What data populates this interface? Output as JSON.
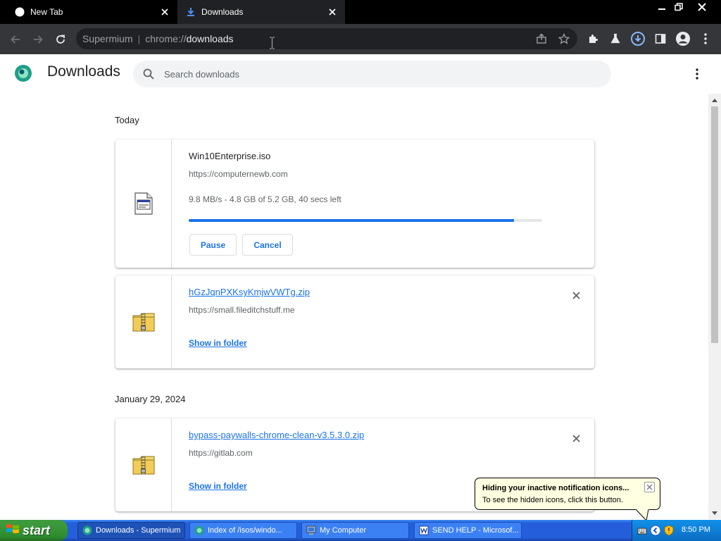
{
  "browser": {
    "tabs": [
      {
        "title": "New Tab",
        "icon": "globe-icon"
      },
      {
        "title": "Downloads",
        "icon": "download-icon"
      }
    ],
    "omnibox": {
      "brand": "Supermium",
      "separator": "|",
      "scheme": "chrome://",
      "host": "downloads"
    }
  },
  "downloads_page": {
    "title": "Downloads",
    "search_placeholder": "Search downloads",
    "sections": [
      {
        "date": "Today",
        "items": [
          {
            "filename": "Win10Enterprise.iso",
            "url": "https://computernewb.com",
            "status": "9.8 MB/s - 4.8 GB of 5.2 GB, 40 secs left",
            "progress_fraction": 0.92,
            "pause_label": "Pause",
            "cancel_label": "Cancel"
          },
          {
            "filename": "hGzJqnPXKsyKmjwVWTg.zip",
            "url": "https://small.fileditchstuff.me",
            "action_label": "Show in folder"
          }
        ]
      },
      {
        "date": "January 29, 2024",
        "items": [
          {
            "filename": "bypass-paywalls-chrome-clean-v3.5.3.0.zip",
            "url": "https://gitlab.com",
            "action_label": "Show in folder"
          }
        ]
      }
    ]
  },
  "balloon": {
    "title": "Hiding your inactive notification icons...",
    "text": "To see the hidden icons, click this button."
  },
  "taskbar": {
    "start_label": "start",
    "items": [
      {
        "label": "Downloads - Supermium",
        "active": true
      },
      {
        "label": "Index of /isos/windo...",
        "active": false
      },
      {
        "label": "My Computer",
        "active": false
      },
      {
        "label": "SEND HELP - Microsof...",
        "active": false
      }
    ],
    "clock": "8:50 PM"
  },
  "colors": {
    "accent": "#1a73e8",
    "taskbar_blue": "#245edb",
    "start_green": "#3c9a3c"
  }
}
